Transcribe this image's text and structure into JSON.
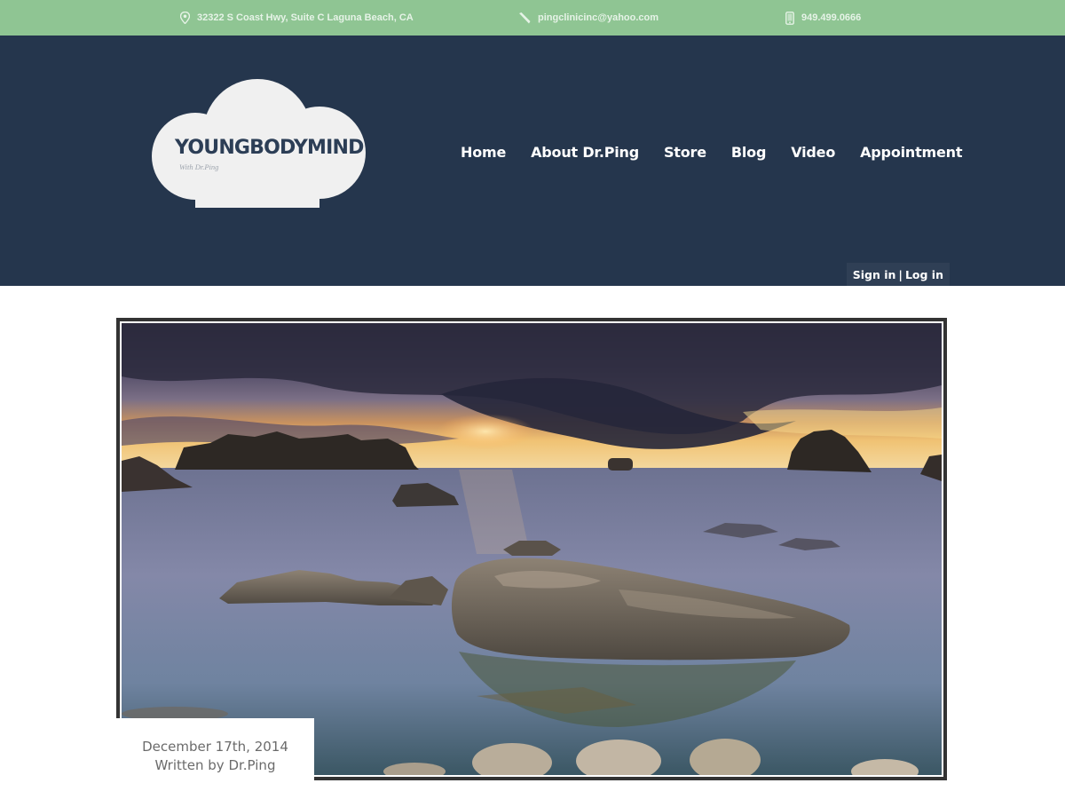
{
  "topbar": {
    "address": "32322 S Coast Hwy, Suite C Laguna Beach, CA",
    "email": "pingclinicinc@yahoo.com",
    "phone": "949.499.0666",
    "address_icon": "map-pin-icon",
    "email_icon": "pencil-icon",
    "phone_icon": "mobile-phone-icon"
  },
  "logo": {
    "title": "YOUNGBODYMIND",
    "subtitle": "With Dr.Ping"
  },
  "nav": {
    "items": [
      {
        "label": "Home"
      },
      {
        "label": "About Dr.Ping"
      },
      {
        "label": "Store"
      },
      {
        "label": "Blog"
      },
      {
        "label": "Video"
      },
      {
        "label": "Appointment"
      }
    ]
  },
  "auth": {
    "sign_in": "Sign in",
    "separator": "|",
    "log_in": "Log in"
  },
  "post": {
    "date": "December 17th, 2014",
    "author": "Written by Dr.Ping"
  },
  "colors": {
    "topbar": "#8fc593",
    "header": "#25364d",
    "frame": "#333333"
  }
}
